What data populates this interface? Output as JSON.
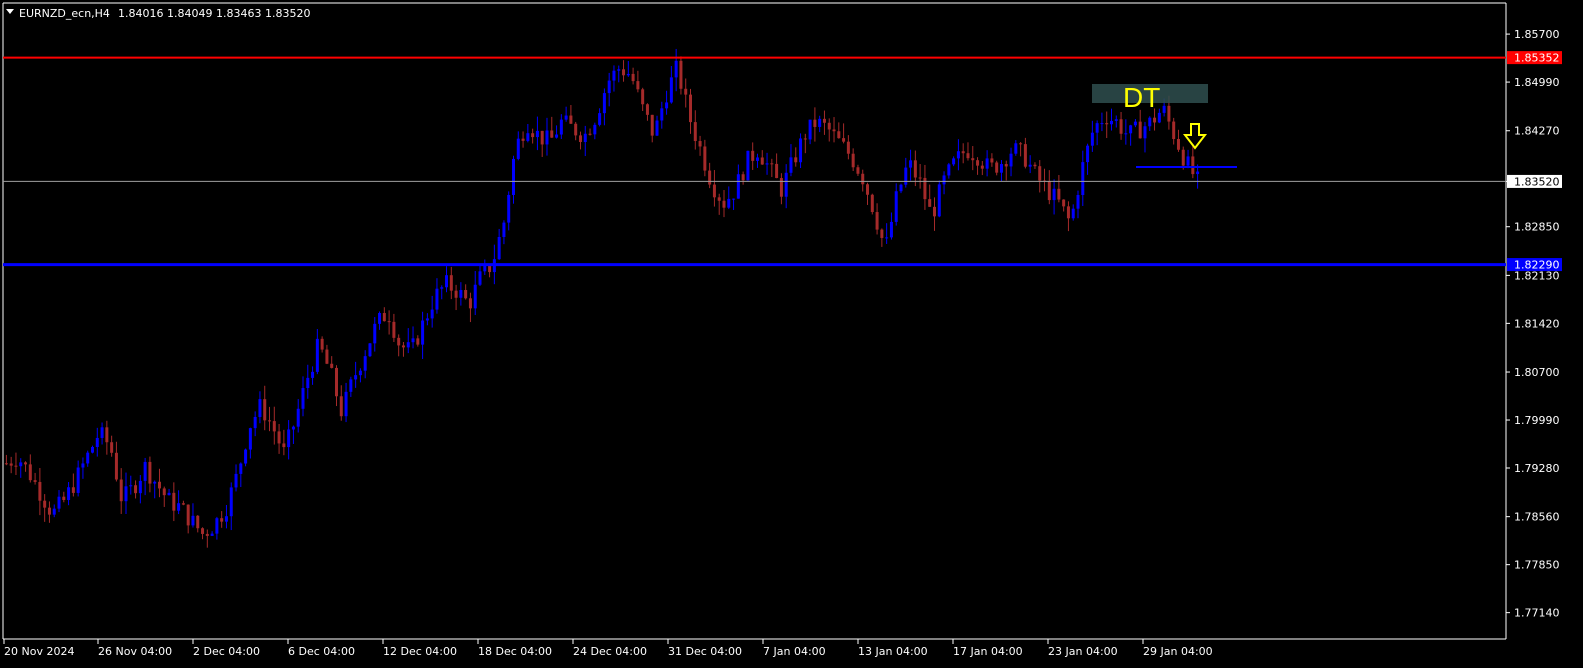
{
  "header": {
    "symbol": "EURNZD_ecn,H4",
    "ohlc": "1.84016 1.84049 1.83463 1.83520"
  },
  "colors": {
    "background": "#000000",
    "bull": "#0000ff",
    "bear": "#a52a2a",
    "axis": "#ffffff",
    "resistance": "#ff0000",
    "support": "#0000ff",
    "bid": "#a0a0a0",
    "pattern_box": "#2f4f4f",
    "annotation": "#ffff00"
  },
  "chart_data": {
    "type": "candlestick",
    "title": "EURNZD_ecn,H4",
    "ylim": [
      1.7675,
      1.8616
    ],
    "y_ticks": [
      "1.85700",
      "1.84990",
      "1.84270",
      "1.83520",
      "1.82850",
      "1.82130",
      "1.81420",
      "1.80700",
      "1.79990",
      "1.79280",
      "1.78560",
      "1.77850",
      "1.77140"
    ],
    "x_ticks": [
      "20 Nov 2024",
      "26 Nov 04:00",
      "2 Dec 04:00",
      "6 Dec 04:00",
      "12 Dec 04:00",
      "18 Dec 04:00",
      "24 Dec 04:00",
      "31 Dec 04:00",
      "7 Jan 04:00",
      "13 Jan 04:00",
      "17 Jan 04:00",
      "23 Jan 04:00",
      "29 Jan 04:00"
    ],
    "levels": [
      {
        "name": "resistance",
        "price": 1.85352,
        "label": "1.85352"
      },
      {
        "name": "support",
        "price": 1.8229,
        "label": "1.82290"
      },
      {
        "name": "bid",
        "price": 1.8352,
        "label": "1.83520"
      }
    ],
    "close_path": [
      1.7935,
      1.7945,
      1.792,
      1.789,
      1.786,
      1.788,
      1.791,
      1.7945,
      1.798,
      1.796,
      1.788,
      1.79,
      1.793,
      1.7905,
      1.788,
      1.787,
      1.785,
      1.783,
      1.7845,
      1.787,
      1.792,
      1.799,
      1.802,
      1.799,
      1.795,
      1.8,
      1.806,
      1.811,
      1.807,
      1.801,
      1.806,
      1.81,
      1.814,
      1.816,
      1.811,
      1.81,
      1.814,
      1.818,
      1.82,
      1.819,
      1.817,
      1.821,
      1.823,
      1.829,
      1.84,
      1.844,
      1.842,
      1.841,
      1.844,
      1.843,
      1.842,
      1.845,
      1.85,
      1.852,
      1.851,
      1.846,
      1.842,
      1.848,
      1.852,
      1.845,
      1.84,
      1.835,
      1.832,
      1.834,
      1.838,
      1.84,
      1.837,
      1.834,
      1.838,
      1.842,
      1.844,
      1.843,
      1.841,
      1.839,
      1.836,
      1.831,
      1.825,
      1.833,
      1.838,
      1.835,
      1.83,
      1.835,
      1.838,
      1.84,
      1.839,
      1.837,
      1.838,
      1.84,
      1.839,
      1.836,
      1.834,
      1.832,
      1.829,
      1.837,
      1.843,
      1.845,
      1.844,
      1.842,
      1.843,
      1.844,
      1.846,
      1.842,
      1.838,
      1.8352
    ],
    "annotations": {
      "pattern_label": "DT",
      "arrow": "down-arrow-icon"
    }
  }
}
